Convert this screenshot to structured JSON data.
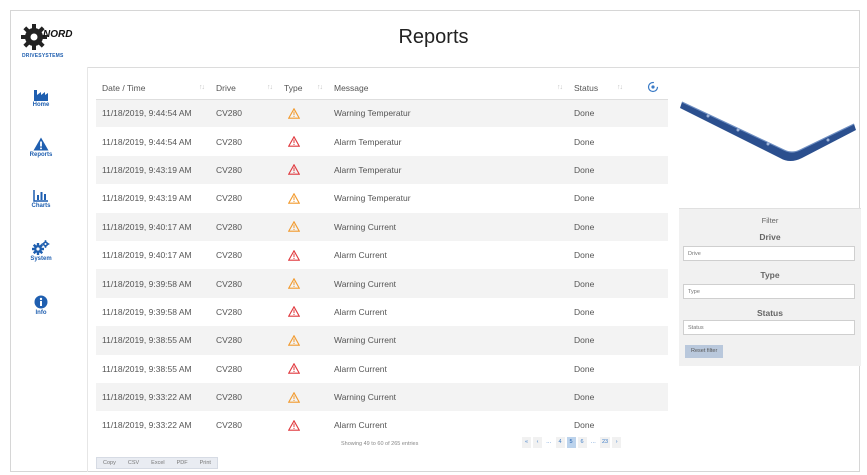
{
  "header": {
    "title": "Reports",
    "logo_text": "DRIVESYSTEMS",
    "logo_brand": "NORD"
  },
  "sidebar": {
    "items": [
      {
        "label": "Home",
        "icon": "factory-icon"
      },
      {
        "label": "Reports",
        "icon": "warning-icon"
      },
      {
        "label": "Charts",
        "icon": "chart-icon"
      },
      {
        "label": "System",
        "icon": "gears-icon"
      },
      {
        "label": "Info",
        "icon": "info-icon"
      }
    ]
  },
  "table": {
    "columns": [
      "Date / Time",
      "Drive",
      "Type",
      "Message",
      "Status"
    ],
    "rows": [
      {
        "datetime": "11/18/2019, 9:44:54 AM",
        "drive": "CV280",
        "type": "warning",
        "message": "Warning Temperatur",
        "status": "Done"
      },
      {
        "datetime": "11/18/2019, 9:44:54 AM",
        "drive": "CV280",
        "type": "alarm",
        "message": "Alarm Temperatur",
        "status": "Done"
      },
      {
        "datetime": "11/18/2019, 9:43:19 AM",
        "drive": "CV280",
        "type": "alarm",
        "message": "Alarm Temperatur",
        "status": "Done"
      },
      {
        "datetime": "11/18/2019, 9:43:19 AM",
        "drive": "CV280",
        "type": "warning",
        "message": "Warning Temperatur",
        "status": "Done"
      },
      {
        "datetime": "11/18/2019, 9:40:17 AM",
        "drive": "CV280",
        "type": "warning",
        "message": "Warning Current",
        "status": "Done"
      },
      {
        "datetime": "11/18/2019, 9:40:17 AM",
        "drive": "CV280",
        "type": "alarm",
        "message": "Alarm Current",
        "status": "Done"
      },
      {
        "datetime": "11/18/2019, 9:39:58 AM",
        "drive": "CV280",
        "type": "warning",
        "message": "Warning Current",
        "status": "Done"
      },
      {
        "datetime": "11/18/2019, 9:39:58 AM",
        "drive": "CV280",
        "type": "alarm",
        "message": "Alarm Current",
        "status": "Done"
      },
      {
        "datetime": "11/18/2019, 9:38:55 AM",
        "drive": "CV280",
        "type": "warning",
        "message": "Warning Current",
        "status": "Done"
      },
      {
        "datetime": "11/18/2019, 9:38:55 AM",
        "drive": "CV280",
        "type": "alarm",
        "message": "Alarm Current",
        "status": "Done"
      },
      {
        "datetime": "11/18/2019, 9:33:22 AM",
        "drive": "CV280",
        "type": "warning",
        "message": "Warning Current",
        "status": "Done"
      },
      {
        "datetime": "11/18/2019, 9:33:22 AM",
        "drive": "CV280",
        "type": "alarm",
        "message": "Alarm Current",
        "status": "Done"
      }
    ]
  },
  "footer": {
    "info": "Showing 49 to 60 of 265 entries",
    "pager": [
      "«",
      "‹",
      "…",
      "4",
      "5",
      "6",
      "…",
      "23",
      "›"
    ],
    "pager_active": "5",
    "export_buttons": [
      "Copy",
      "CSV",
      "Excel",
      "PDF",
      "Print"
    ]
  },
  "filter": {
    "title": "Filter",
    "drive_label": "Drive",
    "drive_placeholder": "Drive",
    "type_label": "Type",
    "type_placeholder": "Type",
    "status_label": "Status",
    "status_placeholder": "Status",
    "reset_label": "Reset filter"
  },
  "colors": {
    "accent": "#1f5fb0",
    "warning": "#f29a2e",
    "alarm": "#e0393e",
    "row_alt": "#f3f3f3",
    "conveyor": "#2b4f8e"
  }
}
